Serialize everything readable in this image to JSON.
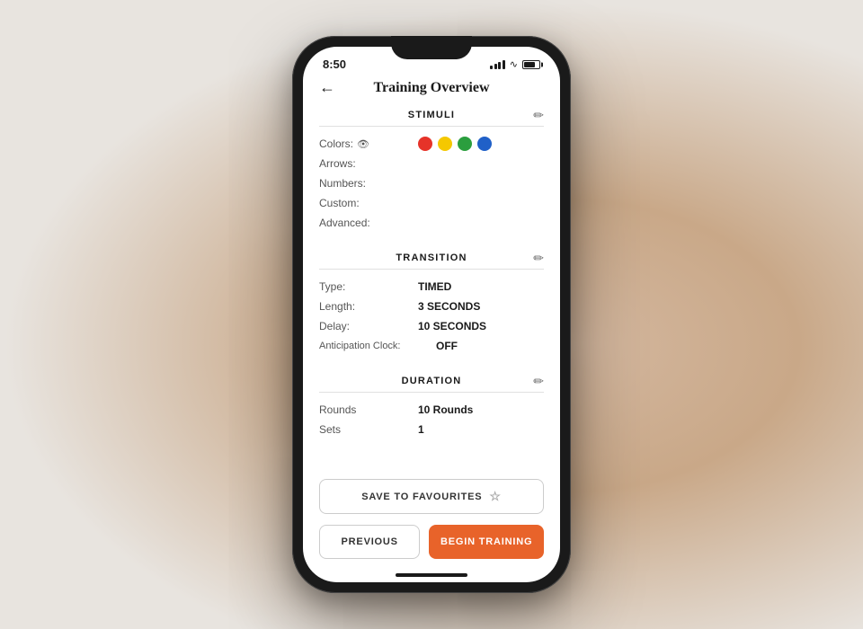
{
  "status_bar": {
    "time": "8:50",
    "arrow": "▶"
  },
  "header": {
    "back_label": "←",
    "title": "Training Overview"
  },
  "stimuli": {
    "section_title": "STIMULI",
    "colors_label": "Colors:",
    "arrows_label": "Arrows:",
    "numbers_label": "Numbers:",
    "custom_label": "Custom:",
    "advanced_label": "Advanced:",
    "colors": [
      {
        "color": "#e63329"
      },
      {
        "color": "#f5c800"
      },
      {
        "color": "#2b9e3e"
      },
      {
        "color": "#2060c8"
      }
    ]
  },
  "transition": {
    "section_title": "TRANSITION",
    "type_label": "Type:",
    "type_value": "TIMED",
    "length_label": "Length:",
    "length_value": "3 SECONDS",
    "delay_label": "Delay:",
    "delay_value": "10 SECONDS",
    "anticipation_label": "Anticipation Clock:",
    "anticipation_value": "OFF"
  },
  "duration": {
    "section_title": "DURATION",
    "rounds_label": "Rounds",
    "rounds_value": "10 Rounds",
    "sets_label": "Sets",
    "sets_value": "1"
  },
  "buttons": {
    "save_label": "SAVE TO FAVOURITES",
    "previous_label": "PREVIOUS",
    "begin_label": "BEGIN TRAINING"
  },
  "colors": {
    "accent": "#e8632a"
  }
}
